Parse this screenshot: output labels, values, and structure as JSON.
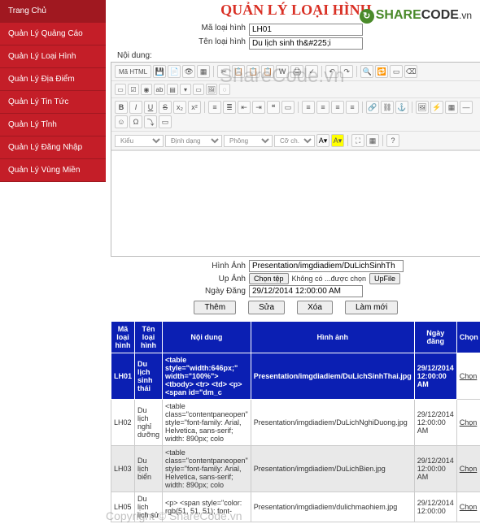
{
  "watermark_center": "ShareCode.vn",
  "watermark_brand": {
    "share": "SHARE",
    "code": "CODE",
    "vn": ".vn",
    "icon": "↻"
  },
  "watermark_footer": "Copyright © ShareCode.vn",
  "sidebar": {
    "items": [
      {
        "label": "Trang Chủ"
      },
      {
        "label": "Quản Lý Quảng Cáo"
      },
      {
        "label": "Quản Lý Loại Hình"
      },
      {
        "label": "Quản Lý Địa Điểm"
      },
      {
        "label": "Quản Lý Tin Tức"
      },
      {
        "label": "Quản Lý Tỉnh"
      },
      {
        "label": "Quản Lý Đăng Nhập"
      },
      {
        "label": "Quản Lý Vùng Miền"
      }
    ]
  },
  "page_title": "QUẢN LÝ LOẠI HÌNH",
  "form": {
    "ma_label": "Mã loại hình",
    "ma_value": "LH01",
    "ten_label": "Tên loại hình",
    "ten_value": "Du lịch sinh th&#225;i",
    "noidung_label": "Nội dung:",
    "hinhanh_label": "Hình Ảnh",
    "hinhanh_value": "Presentation/imgdiadiem/DuLichSinhTh",
    "upanh_label": "Up Ảnh",
    "choose_btn": "Chọn tệp",
    "choose_text": "Không có ...được chọn",
    "upfile_btn": "UpFile",
    "ngaydang_label": "Ngày Đăng",
    "ngaydang_value": "29/12/2014 12:00:00 AM"
  },
  "editor": {
    "html_btn": "Mã HTML",
    "style_sel": "Kiểu",
    "format_sel": "Định dạng",
    "font_sel": "Phông",
    "size_sel": "Cỡ ch..."
  },
  "actions": {
    "them": "Thêm",
    "sua": "Sửa",
    "xoa": "Xóa",
    "lammoi": "Làm mới"
  },
  "table": {
    "headers": {
      "ma": "Mã loại hình",
      "ten": "Tên loại hình",
      "noidung": "Nội dung",
      "hinhanh": "Hình ảnh",
      "ngaydang": "Ngày đăng",
      "chon": "Chọn"
    },
    "rows": [
      {
        "highlight": true,
        "ma": "LH01",
        "ten": "Du lịch sinh thái",
        "noidung": "<table style=\"width:646px;\" width=\"100%\"> <tbody> <tr> <td> <p> <span id=\"dm_c",
        "hinhanh": "Presentation/imgdiadiem/DuLichSinhThai.jpg",
        "ngaydang": "29/12/2014 12:00:00 AM",
        "chon": "Chọn"
      },
      {
        "highlight": false,
        "ma": "LH02",
        "ten": "Du lịch nghỉ dưỡng",
        "noidung": "<table class=\"contentpaneopen\" style=\"font-family: Arial, Helvetica, sans-serif; width: 890px; colo",
        "hinhanh": "Presentation/imgdiadiem/DuLichNghiDuong.jpg",
        "ngaydang": "29/12/2014 12:00:00 AM",
        "chon": "Chọn"
      },
      {
        "highlight": false,
        "alt": true,
        "ma": "LH03",
        "ten": "Du lịch biển",
        "noidung": "<table class=\"contentpaneopen\" style=\"font-family: Arial, Helvetica, sans-serif; width: 890px; colo",
        "hinhanh": "Presentation/imgdiadiem/DuLichBien.jpg",
        "ngaydang": "29/12/2014 12:00:00 AM",
        "chon": "Chọn"
      },
      {
        "highlight": false,
        "ma": "LH05",
        "ten": "Du lịch lịch sử",
        "noidung": "<p> <span style=\"color: rgb(51, 51, 51); font-",
        "hinhanh": "Presentation/imgdiadiem/dulichmaohiem.jpg",
        "ngaydang": "29/12/2014 12:00:00",
        "chon": "Chọn"
      }
    ]
  }
}
